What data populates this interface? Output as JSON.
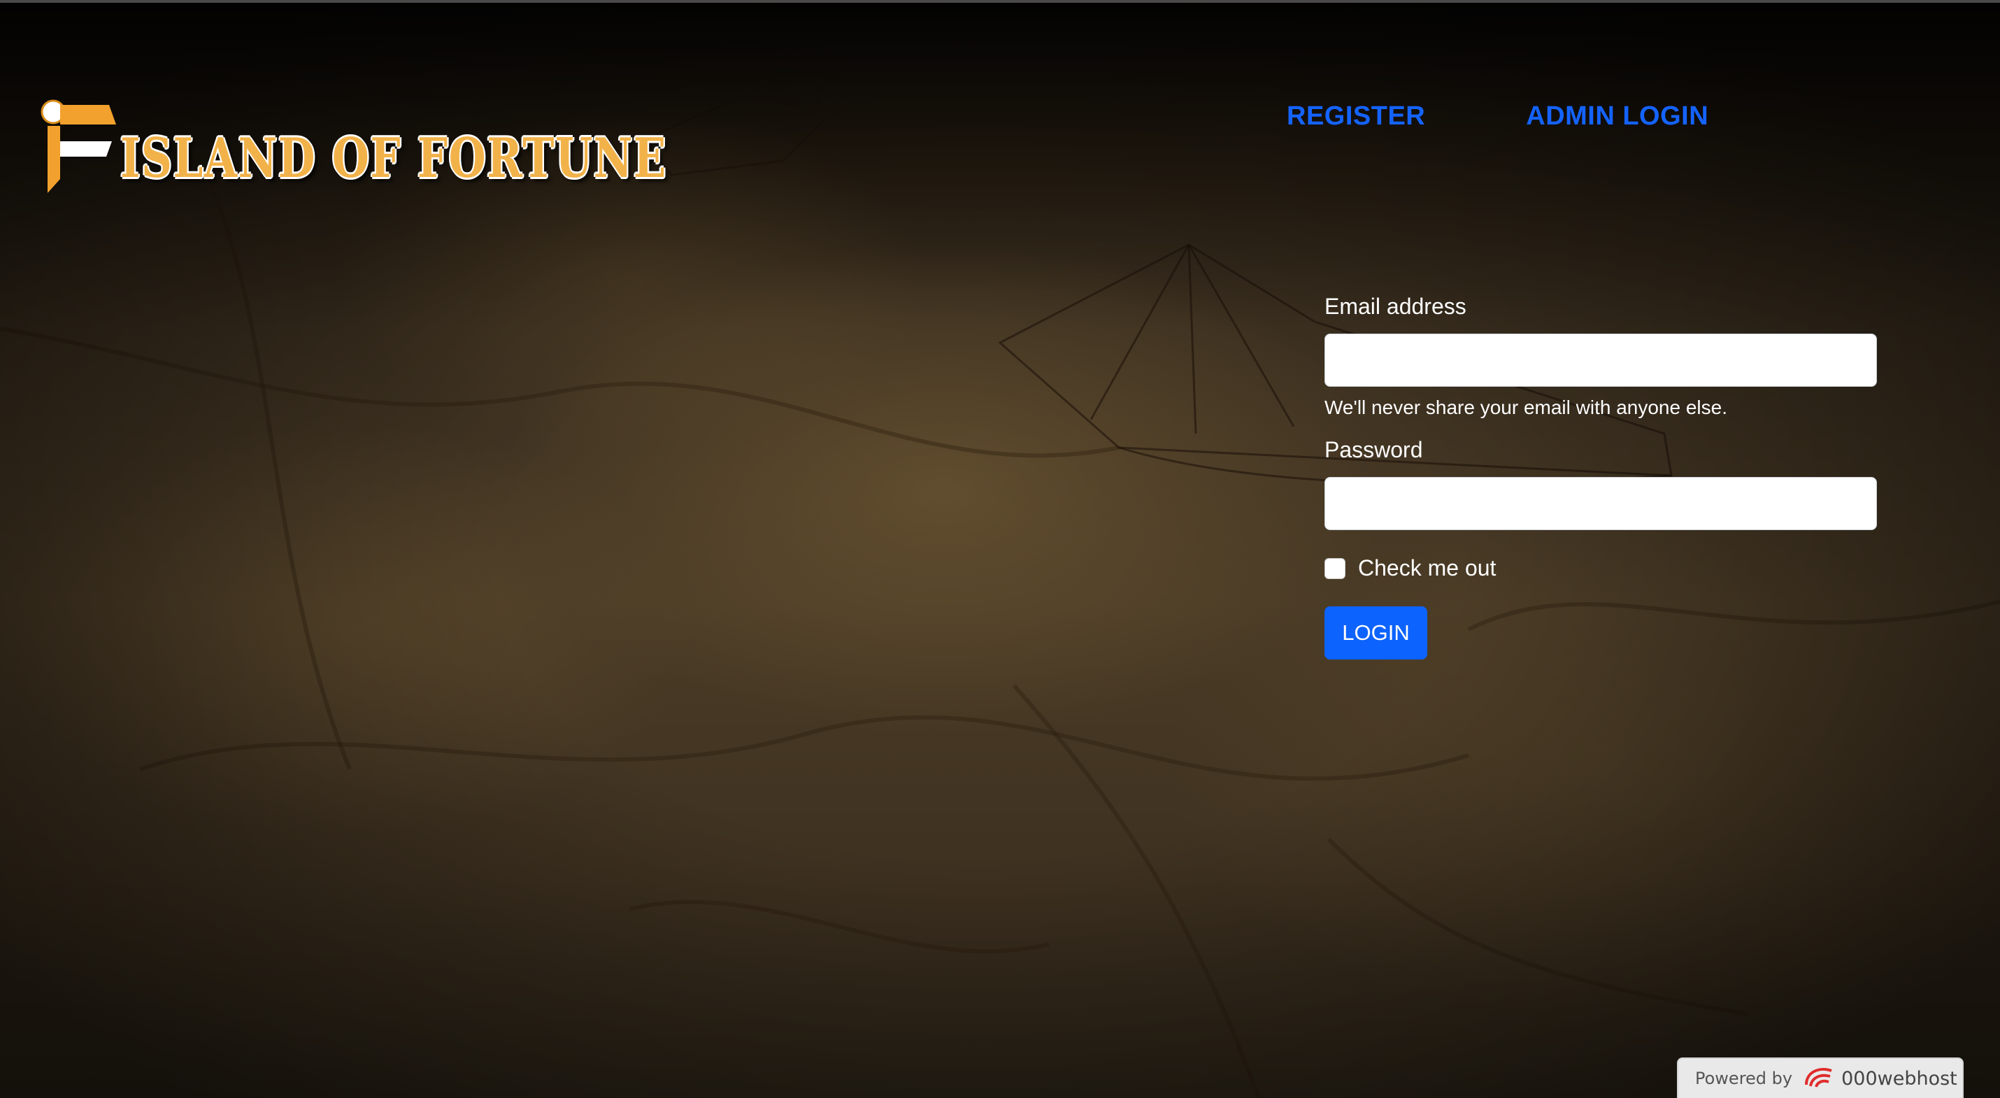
{
  "brand": {
    "logo_letter": "F",
    "title": "ISLAND OF FORTUNE",
    "accent": "#f2b24a"
  },
  "nav": {
    "register": "REGISTER",
    "admin_login": "ADMIN LOGIN",
    "link_color": "#1463ff"
  },
  "form": {
    "email_label": "Email address",
    "email_value": "",
    "email_help": "We'll never share your email with anyone else.",
    "password_label": "Password",
    "password_value": "",
    "checkbox_label": "Check me out",
    "checkbox_checked": false,
    "submit_label": "LOGIN",
    "submit_color": "#0d63fd"
  },
  "footer": {
    "powered_by": "Powered by",
    "host_name": "000webhost",
    "host_icon": "000webhost-logo-icon"
  }
}
